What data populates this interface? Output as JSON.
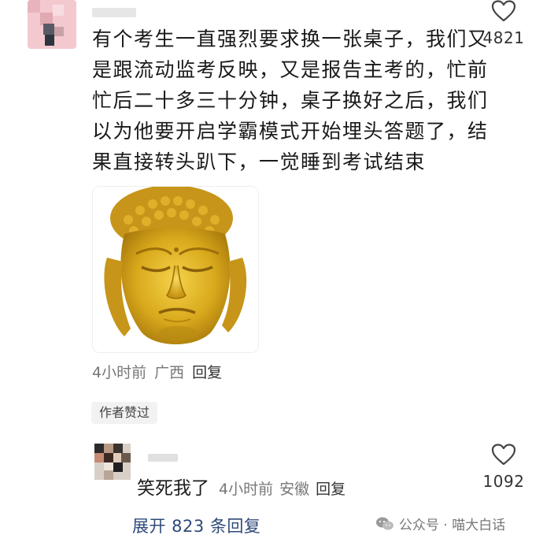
{
  "comment": {
    "lines": [
      "有个考生一直强烈要求换一张桌子，我们又",
      "是跟流动监考反映，又是报告主考的，忙前",
      "忙后二十多三十分钟，桌子换好之后，我们",
      "以为他要开启学霸模式开始埋头答题了，结",
      "果直接转头趴下，一觉睡到考试结束"
    ],
    "like_count": "4821",
    "meta": {
      "time": "4小时前",
      "location": "广西",
      "reply": "回复"
    },
    "author_liked": "作者赞过",
    "image_icon": "golden-buddha-head"
  },
  "reply": {
    "text": "笑死我了",
    "time": "4小时前",
    "location": "安徽",
    "reply_label": "回复",
    "like_count": "1092"
  },
  "expand_label": "展开 823 条回复",
  "watermark": "公众号 · 喵大白话",
  "colors": {
    "accent_link": "#2e4a7a",
    "muted": "#777777",
    "text": "#1a1a1a"
  }
}
